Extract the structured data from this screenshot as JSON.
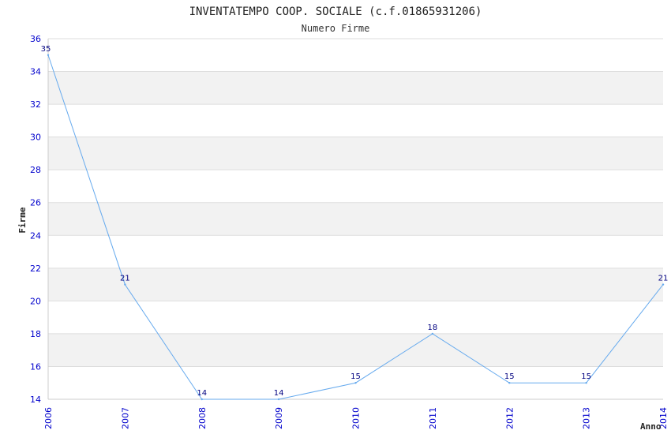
{
  "chart_data": {
    "type": "line",
    "title": "INVENTATEMPO COOP. SOCIALE (c.f.01865931206)",
    "subtitle": "Numero Firme",
    "xlabel": "Anno",
    "ylabel": "Firme",
    "x": [
      "2006",
      "2007",
      "2008",
      "2009",
      "2010",
      "2011",
      "2012",
      "2013",
      "2014"
    ],
    "series": [
      {
        "values": [
          35,
          21,
          14,
          14,
          15,
          18,
          15,
          15,
          21
        ]
      }
    ],
    "ylim": [
      14,
      36
    ],
    "yticks": [
      14,
      16,
      18,
      20,
      22,
      24,
      26,
      28,
      30,
      32,
      34,
      36
    ],
    "grid": true,
    "band_colors": [
      "#ffffff",
      "#f2f2f2"
    ],
    "line_color": "#66aaee",
    "tick_color": "#0000cc",
    "label_color": "#000080"
  }
}
